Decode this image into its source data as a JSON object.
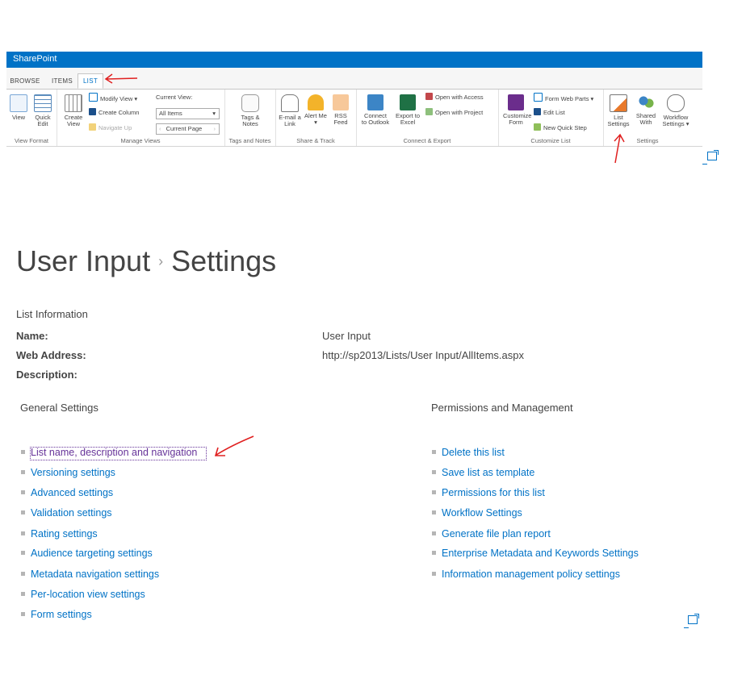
{
  "suite": {
    "brand": "SharePoint"
  },
  "tabs": [
    {
      "label": "BROWSE"
    },
    {
      "label": "ITEMS"
    },
    {
      "label": "LIST"
    }
  ],
  "ribbon": {
    "view_format": {
      "view": "View",
      "quick_edit": "Quick Edit",
      "group": "View Format"
    },
    "manage_views": {
      "create_view": "Create View",
      "modify_view": "Modify View",
      "create_column": "Create Column",
      "navigate_up": "Navigate Up",
      "current_view_label": "Current View:",
      "current_view_value": "All Items",
      "current_page": "Current Page",
      "group": "Manage Views"
    },
    "tags": {
      "tags_notes": "Tags & Notes",
      "group": "Tags and Notes"
    },
    "share": {
      "email_link": "E-mail a Link",
      "alert_me": "Alert Me",
      "rss_feed": "RSS Feed",
      "group": "Share & Track"
    },
    "connect": {
      "connect_outlook": "Connect to Outlook",
      "export_excel": "Export to Excel",
      "open_access": "Open with Access",
      "open_project": "Open with Project",
      "group": "Connect & Export"
    },
    "customize": {
      "customize_form": "Customize Form",
      "form_web_parts": "Form Web Parts",
      "edit_list": "Edit List",
      "new_quick_step": "New Quick Step",
      "group": "Customize List"
    },
    "settings": {
      "list_settings": "List Settings",
      "shared_with": "Shared With",
      "workflow_settings": "Workflow Settings",
      "group": "Settings"
    }
  },
  "page": {
    "title_part1": "User Input",
    "title_part2": "Settings",
    "list_info_heading": "List Information",
    "name_label": "Name:",
    "name_value": "User Input",
    "web_address_label": "Web Address:",
    "web_address_value": "http://sp2013/Lists/User Input/AllItems.aspx",
    "description_label": "Description:"
  },
  "general": {
    "heading": "General Settings",
    "links": [
      "List name, description and navigation",
      "Versioning settings",
      "Advanced settings",
      "Validation settings",
      "Rating settings",
      "Audience targeting settings",
      "Metadata navigation settings",
      "Per-location view settings",
      "Form settings"
    ]
  },
  "permissions": {
    "heading": "Permissions and Management",
    "links": [
      "Delete this list",
      "Save list as template",
      "Permissions for this list",
      "Workflow Settings",
      "Generate file plan report",
      "Enterprise Metadata and Keywords Settings",
      "Information management policy settings"
    ]
  },
  "colors": {
    "accent": "#0072c6",
    "visited": "#663399",
    "annotation": "#e02020"
  }
}
